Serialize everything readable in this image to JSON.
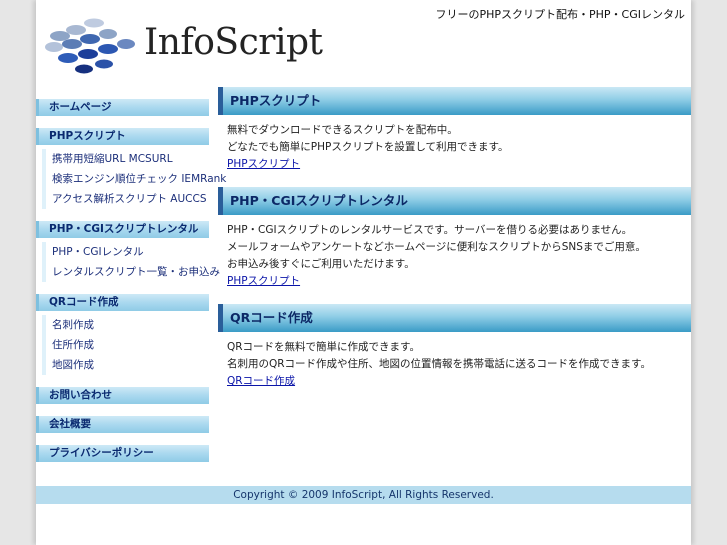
{
  "header": {
    "logo_text": "InfoScript",
    "tagline": "フリーのPHPスクリプト配布・PHP・CGIレンタル"
  },
  "sidebar": {
    "groups": [
      {
        "title": "ホームページ",
        "items": []
      },
      {
        "title": "PHPスクリプト",
        "items": [
          "携帯用短縮URL MCSURL",
          "検索エンジン順位チェック IEMRank",
          "アクセス解析スクリプト AUCCS"
        ]
      },
      {
        "title": "PHP・CGIスクリプトレンタル",
        "items": [
          "PHP・CGIレンタル",
          "レンタルスクリプト一覧・お申込み"
        ]
      },
      {
        "title": "QRコード作成",
        "items": [
          "名刺作成",
          "住所作成",
          "地図作成"
        ]
      },
      {
        "title": "お問い合わせ",
        "items": []
      },
      {
        "title": "会社概要",
        "items": []
      },
      {
        "title": "プライバシーポリシー",
        "items": []
      }
    ]
  },
  "main": {
    "sections": [
      {
        "title": "PHPスクリプト",
        "lines": [
          "無料でダウンロードできるスクリプトを配布中。",
          "どなたでも簡単にPHPスクリプトを設置して利用できます。"
        ],
        "link": "PHPスクリプト"
      },
      {
        "title": "PHP・CGIスクリプトレンタル",
        "lines": [
          "PHP・CGIスクリプトのレンタルサービスです。サーバーを借りる必要はありません。",
          "メールフォームやアンケートなどホームページに便利なスクリプトからSNSまでご用意。",
          "お申込み後すぐにご利用いただけます。"
        ],
        "link": "PHPスクリプト"
      },
      {
        "title": "QRコード作成",
        "lines": [
          "QRコードを無料で簡単に作成できます。",
          "名刺用のQRコード作成や住所、地図の位置情報を携帯電話に送るコードを作成できます。"
        ],
        "link": "QRコード作成"
      }
    ]
  },
  "footer": {
    "copyright": "Copyright © 2009 InfoScript, All Rights Reserved."
  },
  "colors": {
    "side_head_text": "#0a2a70",
    "section_head_border": "#2a5e9a",
    "link": "#0a14a8",
    "footer_bg": "#b6dcee"
  }
}
